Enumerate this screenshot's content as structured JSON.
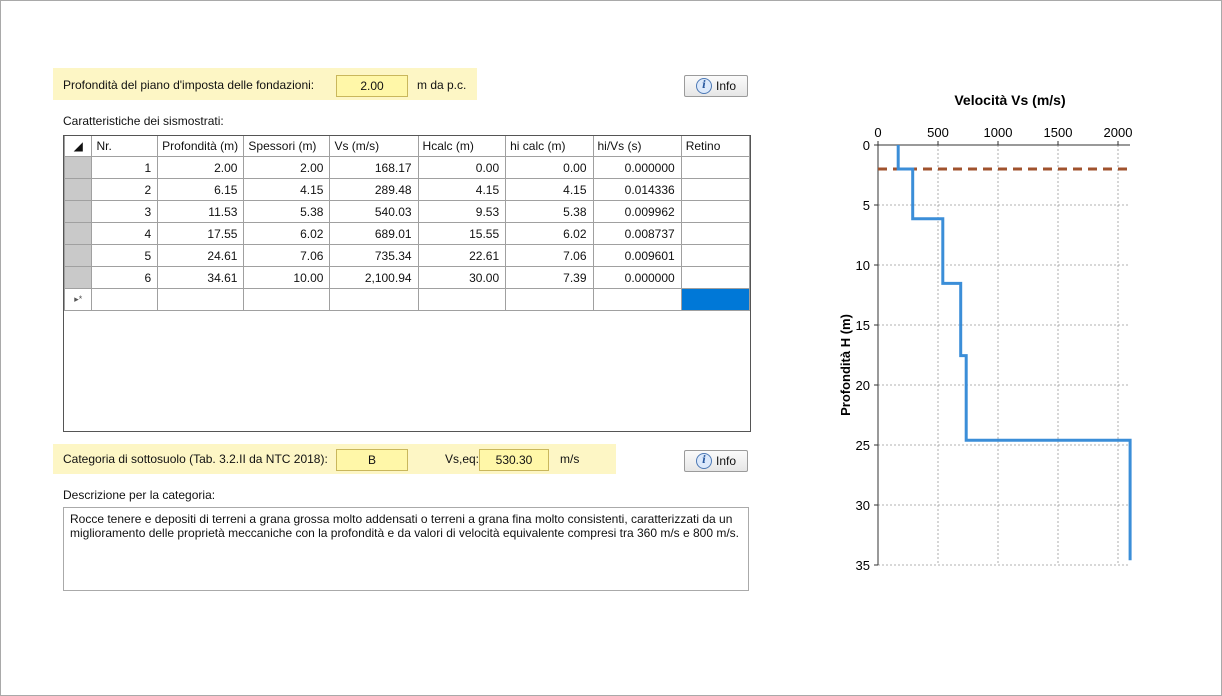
{
  "foundation": {
    "label": "Profondità del piano d'imposta delle fondazioni:",
    "value": "2.00",
    "unit": "m da p.c.",
    "info_label": "Info"
  },
  "strata_title": "Caratteristiche dei sismostrati:",
  "table": {
    "headers": [
      "Nr.",
      "Profondità (m)",
      "Spessori (m)",
      "Vs (m/s)",
      "Hcalc (m)",
      "hi calc (m)",
      "hi/Vs (s)",
      "Retino"
    ],
    "rows": [
      [
        "1",
        "2.00",
        "2.00",
        "168.17",
        "0.00",
        "0.00",
        "0.000000",
        ""
      ],
      [
        "2",
        "6.15",
        "4.15",
        "289.48",
        "4.15",
        "4.15",
        "0.014336",
        ""
      ],
      [
        "3",
        "11.53",
        "5.38",
        "540.03",
        "9.53",
        "5.38",
        "0.009962",
        ""
      ],
      [
        "4",
        "17.55",
        "6.02",
        "689.01",
        "15.55",
        "6.02",
        "0.008737",
        ""
      ],
      [
        "5",
        "24.61",
        "7.06",
        "735.34",
        "22.61",
        "7.06",
        "0.009601",
        ""
      ],
      [
        "6",
        "34.61",
        "10.00",
        "2,100.94",
        "30.00",
        "7.39",
        "0.000000",
        ""
      ]
    ],
    "new_row_marker": "▸*"
  },
  "category": {
    "label": "Categoria di sottosuolo (Tab. 3.2.II da NTC 2018):",
    "value": "B",
    "vseq_label": "Vs,eq:",
    "vseq_value": "530.30",
    "vseq_unit": "m/s",
    "info_label": "Info"
  },
  "description": {
    "label": "Descrizione per la categoria:",
    "text": "Rocce tenere e depositi di terreni a grana grossa molto addensati o terreni a grana fina molto consistenti, caratterizzati da un miglioramento delle proprietà meccaniche con la profondità e da valori di velocità equivalente compresi tra 360 m/s e 800 m/s."
  },
  "chart_data": {
    "type": "line",
    "title": "Velocità Vs (m/s)",
    "xlabel": "",
    "ylabel": "Profondità H (m)",
    "xlim": [
      0,
      2100
    ],
    "ylim": [
      35,
      0
    ],
    "x_ticks": [
      "0",
      "500",
      "1000",
      "1500",
      "2000"
    ],
    "y_ticks": [
      "0",
      "5",
      "10",
      "15",
      "20",
      "25",
      "30",
      "35"
    ],
    "grid": true,
    "x_axis_position": "top",
    "series": [
      {
        "color": "#3b8ed8",
        "points": [
          [
            168.17,
            0
          ],
          [
            168.17,
            2.0
          ],
          [
            289.48,
            2.0
          ],
          [
            289.48,
            6.15
          ],
          [
            540.03,
            6.15
          ],
          [
            540.03,
            11.53
          ],
          [
            689.01,
            11.53
          ],
          [
            689.01,
            17.55
          ],
          [
            735.34,
            17.55
          ],
          [
            735.34,
            24.61
          ],
          [
            2100.94,
            24.61
          ],
          [
            2100.94,
            34.61
          ]
        ]
      }
    ],
    "reference_line": {
      "y": 2.0,
      "color": "#a0522d",
      "style": "dashed"
    }
  }
}
